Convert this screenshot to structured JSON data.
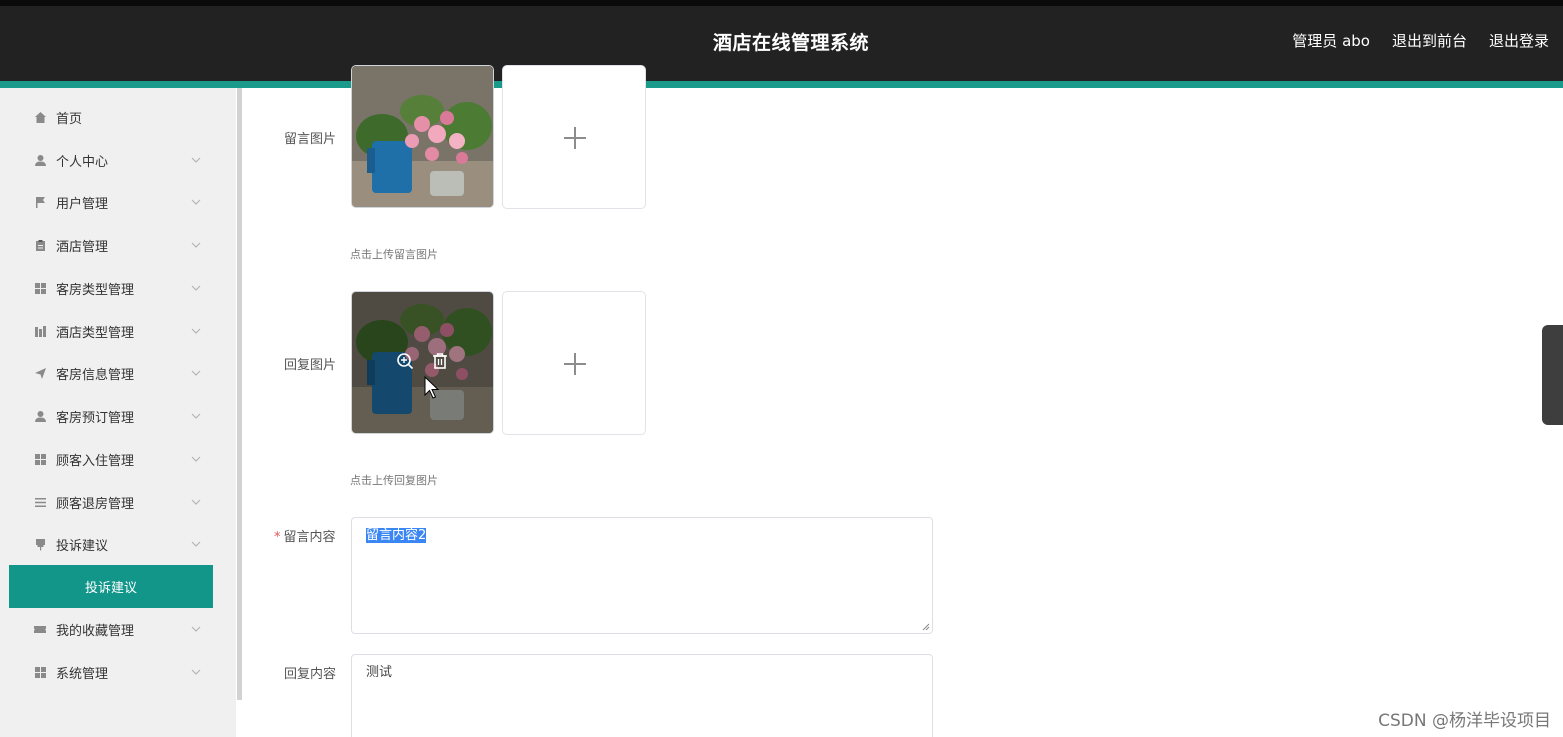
{
  "header": {
    "title": "酒店在线管理系统",
    "links": [
      "管理员 abo",
      "退出到前台",
      "退出登录"
    ]
  },
  "sidebar": {
    "items": [
      {
        "label": "首页",
        "icon": "home-icon",
        "expandable": false
      },
      {
        "label": "个人中心",
        "icon": "user-icon",
        "expandable": true
      },
      {
        "label": "用户管理",
        "icon": "flag-icon",
        "expandable": true
      },
      {
        "label": "酒店管理",
        "icon": "clipboard-icon",
        "expandable": true
      },
      {
        "label": "客房类型管理",
        "icon": "grid-icon",
        "expandable": true
      },
      {
        "label": "酒店类型管理",
        "icon": "bars-icon",
        "expandable": true
      },
      {
        "label": "客房信息管理",
        "icon": "send-icon",
        "expandable": true
      },
      {
        "label": "客房预订管理",
        "icon": "person-icon",
        "expandable": true
      },
      {
        "label": "顾客入住管理",
        "icon": "grid-icon",
        "expandable": true
      },
      {
        "label": "顾客退房管理",
        "icon": "list-icon",
        "expandable": true
      },
      {
        "label": "投诉建议",
        "icon": "pin-icon",
        "expandable": true
      },
      {
        "label": "我的收藏管理",
        "icon": "ticket-icon",
        "expandable": true
      },
      {
        "label": "系统管理",
        "icon": "grid-icon",
        "expandable": true
      }
    ],
    "active_sub": "投诉建议"
  },
  "form": {
    "message_image_label": "留言图片",
    "message_image_hint": "点击上传留言图片",
    "reply_image_label": "回复图片",
    "reply_image_hint": "点击上传回复图片",
    "message_content_label": "留言内容",
    "message_content_value": "留言内容2",
    "reply_content_label": "回复内容",
    "reply_content_value": "测试"
  },
  "watermark": "CSDN @杨洋毕设项目",
  "colors": {
    "header_bg": "#222222",
    "accent": "#1a9a8a",
    "active_menu": "#12968a",
    "sidebar_bg": "#f0f0f0"
  }
}
